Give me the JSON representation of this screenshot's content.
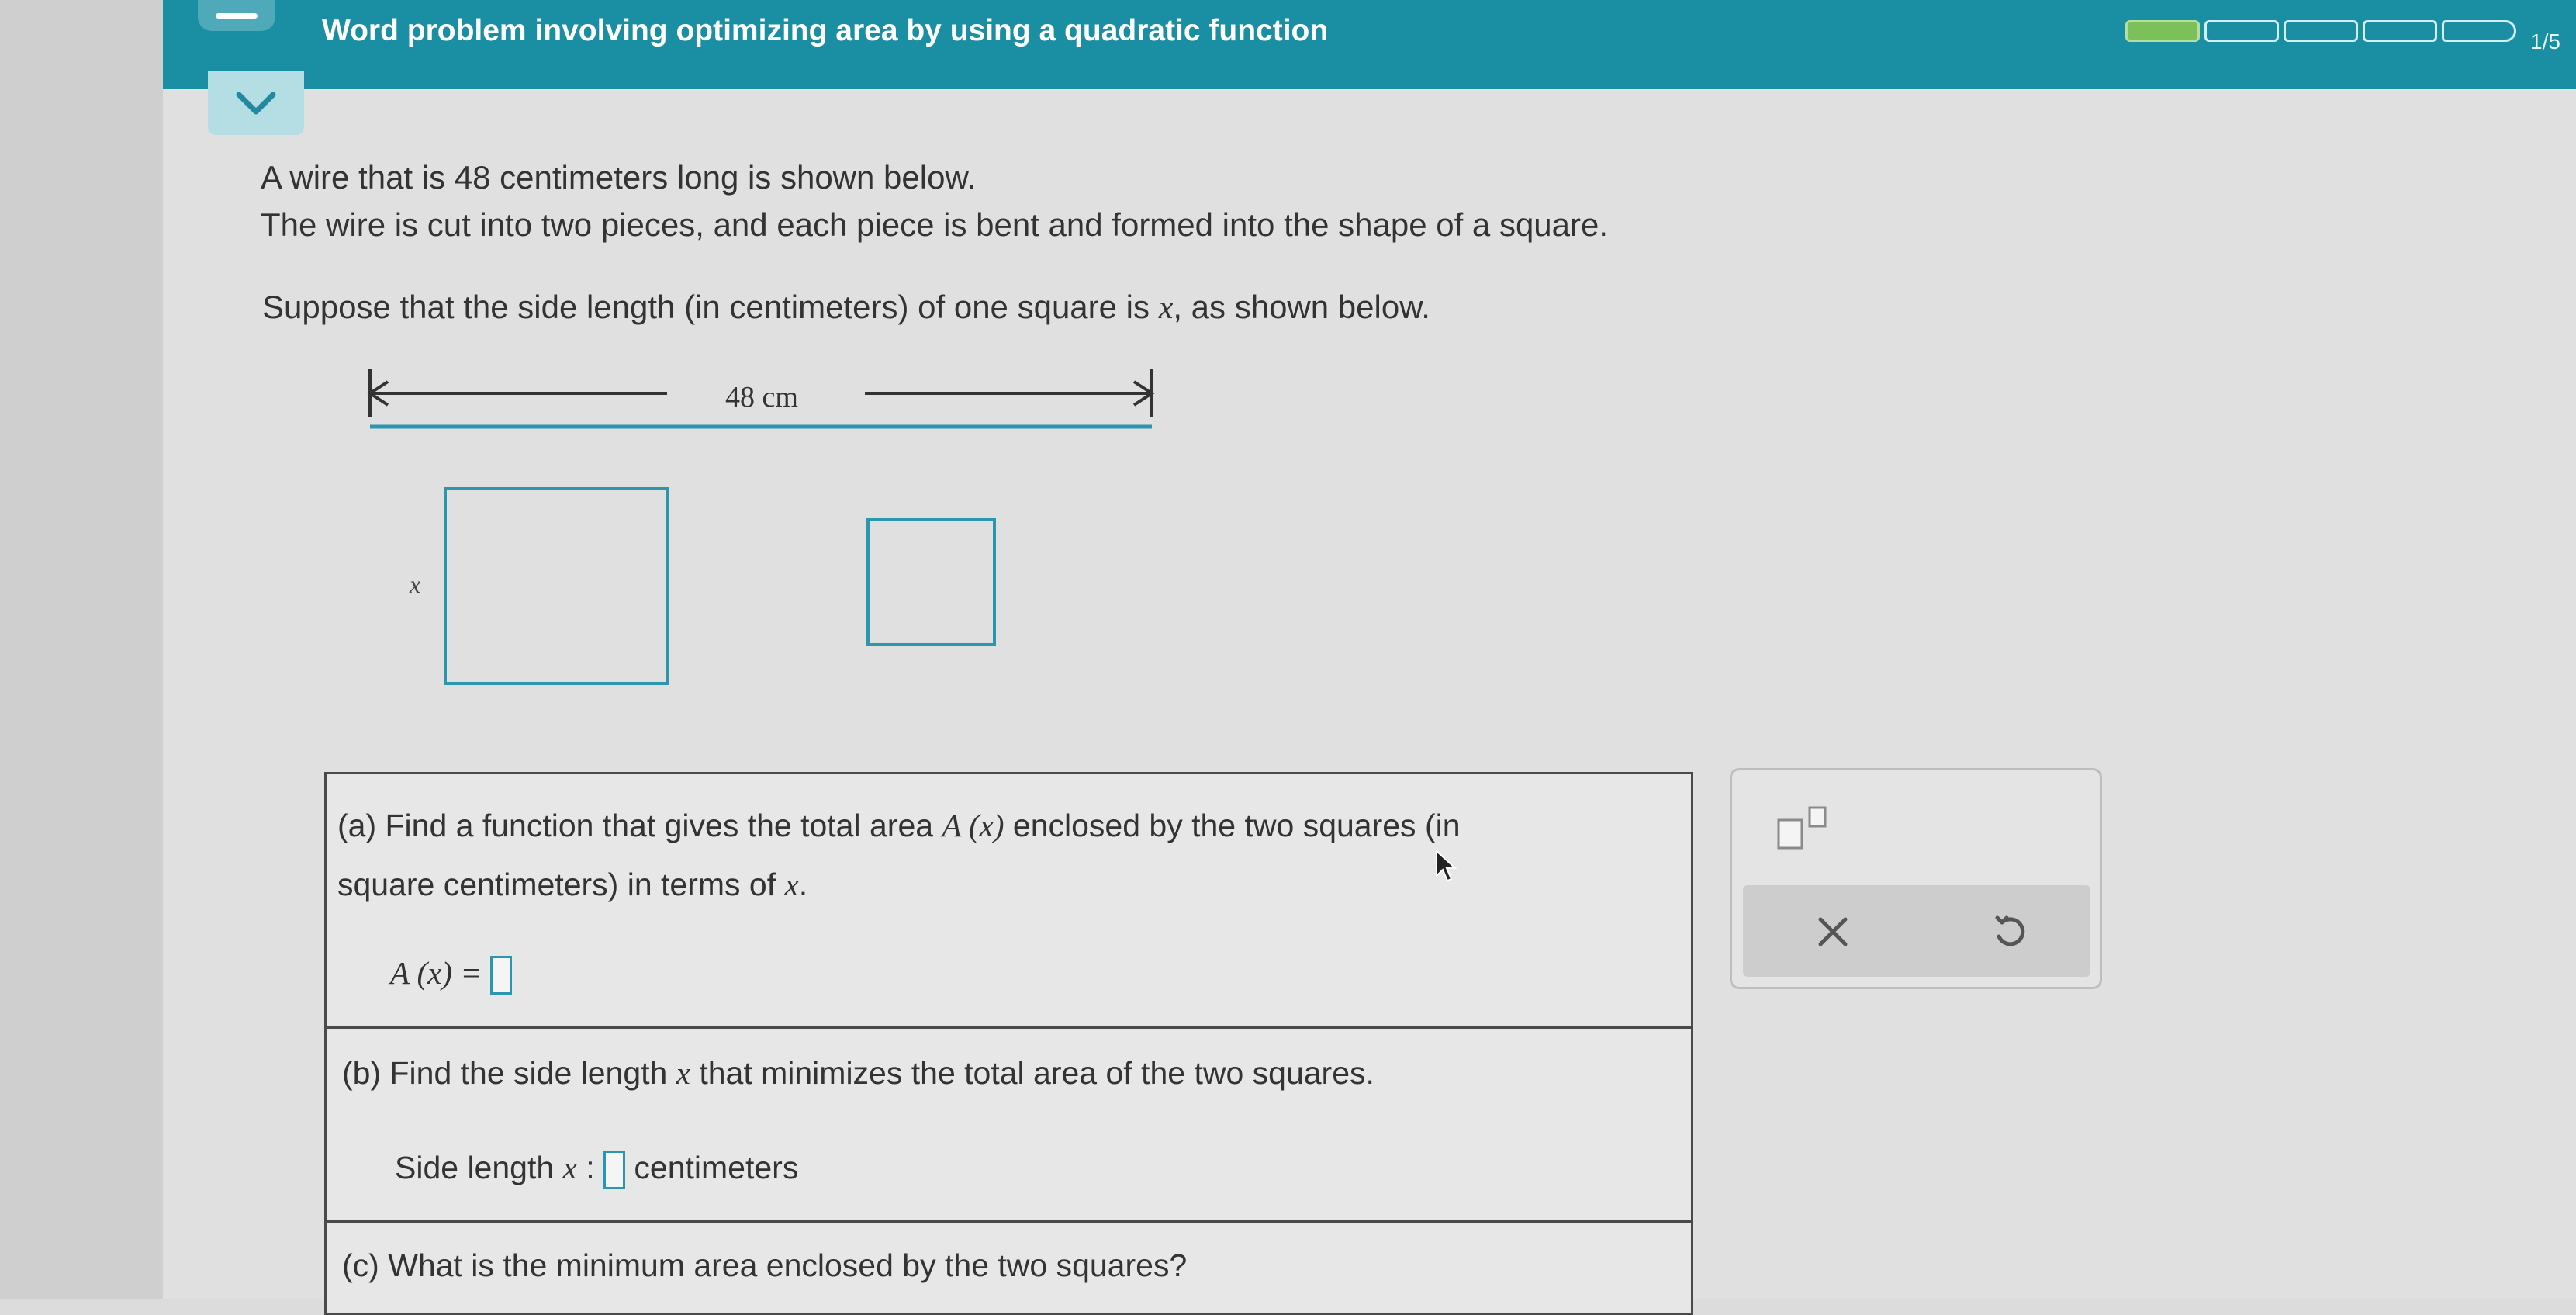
{
  "header": {
    "title": "Word problem involving optimizing area by using a quadratic function",
    "progress": {
      "current": 1,
      "total": 5,
      "text": "1/5"
    },
    "colors": {
      "header": "#1a8ea3",
      "progress_fill": "#7cc05a",
      "accent": "#2a96b0"
    }
  },
  "problem": {
    "line1": "A wire that is 48 centimeters long is shown below.",
    "line2": "The wire is cut into two pieces, and each piece is bent and formed into the shape of a square.",
    "line3_pre": "Suppose that the side length (in centimeters) of one square is ",
    "line3_var": "x",
    "line3_post": ", as shown below."
  },
  "diagram": {
    "wire_label": "48 cm",
    "side_label": "x"
  },
  "parts": {
    "a": {
      "pre": "(a) Find a function that gives the total area ",
      "func": "A (x)",
      "post": " enclosed by the two squares (in",
      "line2_pre": "square centimeters) in terms of ",
      "line2_var": "x",
      "line2_post": ".",
      "answer_label": "A (x) ="
    },
    "b": {
      "pre": "(b) Find the side length ",
      "var": "x",
      "post": " that minimizes the total area of the two squares.",
      "answer_label": "Side length",
      "answer_var": "x",
      "answer_colon": ":",
      "unit": "centimeters"
    },
    "c": {
      "text": "(c) What is the minimum area enclosed by the two squares?"
    }
  },
  "tools": {
    "exponent_icon": "superscript-template-icon",
    "clear_icon": "close-icon",
    "undo_icon": "undo-icon"
  }
}
